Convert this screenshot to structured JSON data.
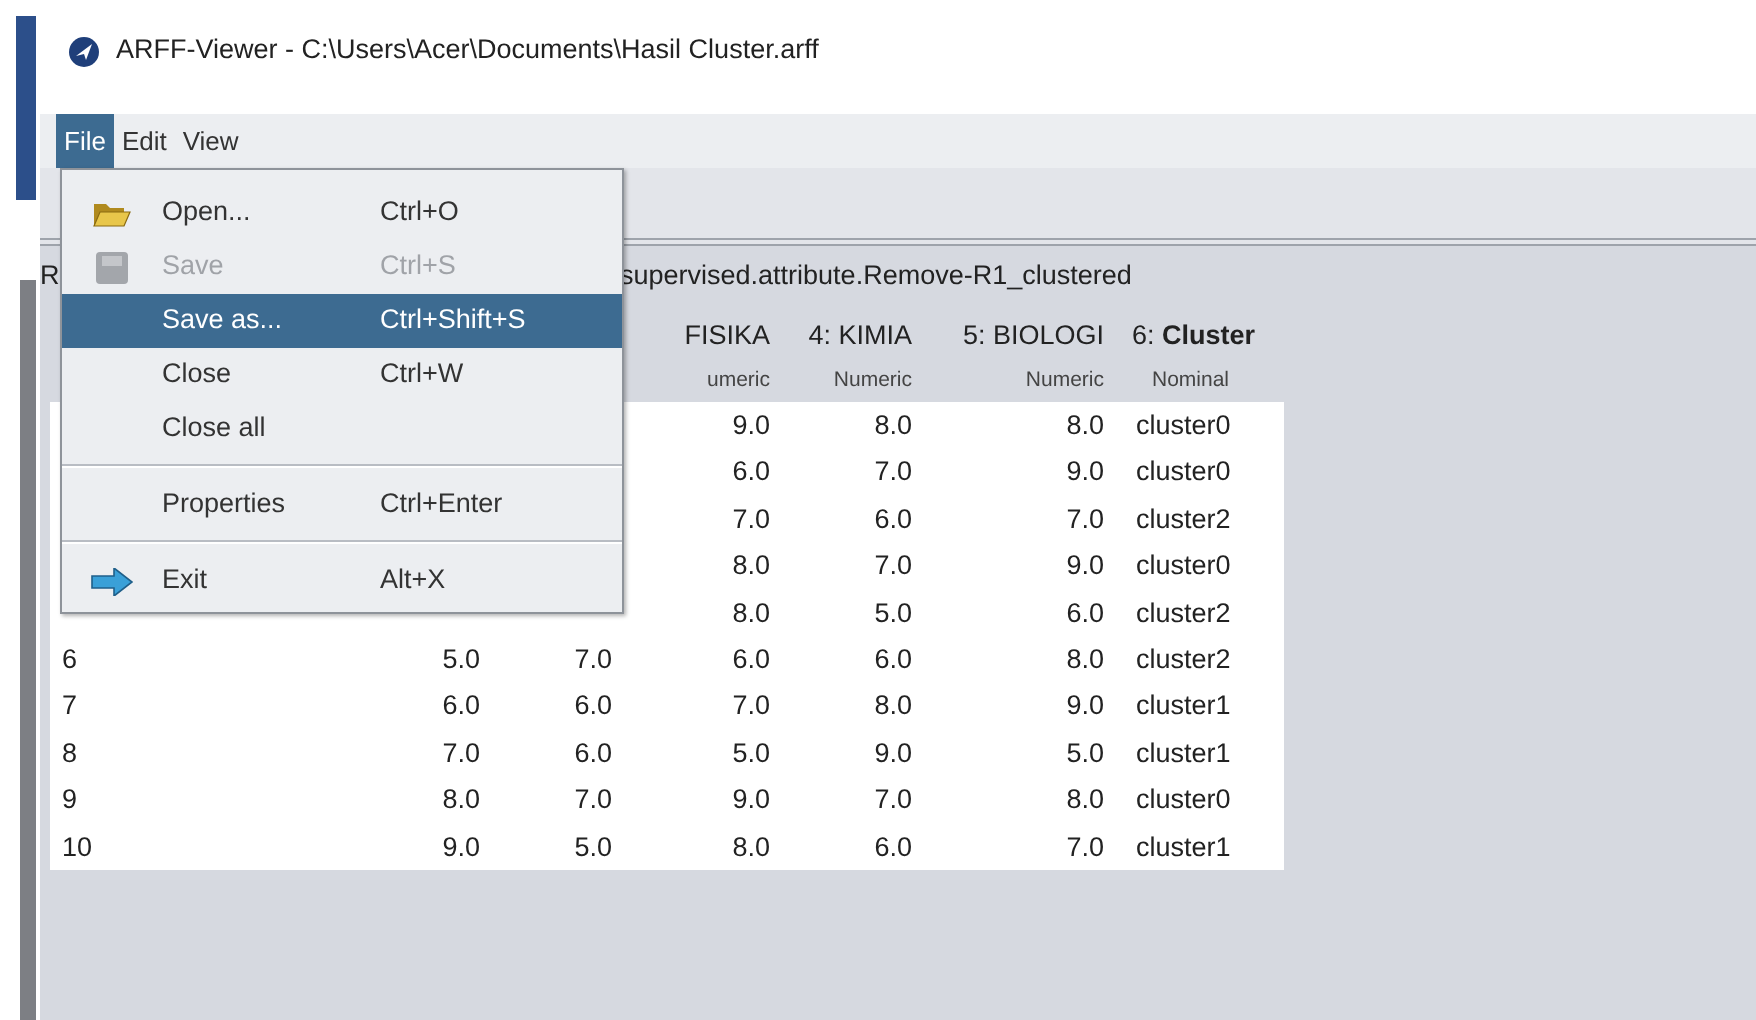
{
  "window": {
    "title": "ARFF-Viewer - C:\\Users\\Acer\\Documents\\Hasil Cluster.arff"
  },
  "menubar": [
    {
      "label": "File",
      "selected": true
    },
    {
      "label": "Edit",
      "selected": false
    },
    {
      "label": "View",
      "selected": false
    }
  ],
  "relation": {
    "start": "R",
    "end": "supervised.attribute.Remove-R1_clustered"
  },
  "table": {
    "columns": [
      {
        "name": "FISIKA",
        "type": "umeric"
      },
      {
        "name": "4: KIMIA",
        "type": "Numeric"
      },
      {
        "name": "5: BIOLOGI",
        "type": "Numeric"
      },
      {
        "name": "6: **Cluster**",
        "type": "Nominal"
      }
    ],
    "rows": [
      {
        "cells": [
          "9.0",
          "8.0",
          "8.0",
          "cluster0"
        ]
      },
      {
        "cells": [
          "6.0",
          "7.0",
          "9.0",
          "cluster0"
        ]
      },
      {
        "cells": [
          "7.0",
          "6.0",
          "7.0",
          "cluster2"
        ]
      },
      {
        "cells": [
          "8.0",
          "7.0",
          "9.0",
          "cluster0"
        ]
      },
      {
        "cells": [
          "8.0",
          "5.0",
          "6.0",
          "cluster2"
        ]
      },
      {
        "cells": [
          "6",
          "5.0",
          "7.0",
          "6.0",
          "6.0",
          "8.0",
          "cluster2"
        ]
      },
      {
        "cells": [
          "7",
          "6.0",
          "6.0",
          "7.0",
          "8.0",
          "9.0",
          "cluster1"
        ]
      },
      {
        "cells": [
          "8",
          "7.0",
          "6.0",
          "5.0",
          "9.0",
          "5.0",
          "cluster1"
        ]
      },
      {
        "cells": [
          "9",
          "8.0",
          "7.0",
          "9.0",
          "7.0",
          "8.0",
          "cluster0"
        ]
      },
      {
        "cells": [
          "10",
          "9.0",
          "5.0",
          "8.0",
          "6.0",
          "7.0",
          "cluster1"
        ]
      }
    ]
  },
  "file_menu": [
    {
      "kind": "item",
      "label": "Open...",
      "shortcut": "Ctrl+O",
      "disabled": false,
      "selected": false
    },
    {
      "kind": "item",
      "label": "Save",
      "shortcut": "Ctrl+S",
      "disabled": true,
      "selected": false
    },
    {
      "kind": "item",
      "label": "Save as...",
      "shortcut": "Ctrl+Shift+S",
      "disabled": false,
      "selected": true
    },
    {
      "kind": "item",
      "label": "Close",
      "shortcut": "Ctrl+W",
      "disabled": false,
      "selected": false
    },
    {
      "kind": "item",
      "label": "Close all",
      "disabled": false,
      "selected": false
    },
    {
      "kind": "separator"
    },
    {
      "kind": "item",
      "label": "Properties",
      "shortcut": "Ctrl+Enter",
      "disabled": false,
      "selected": false
    },
    {
      "kind": "separator"
    },
    {
      "kind": "item",
      "label": "Exit",
      "shortcut": "Alt+X",
      "disabled": false,
      "selected": false
    }
  ]
}
